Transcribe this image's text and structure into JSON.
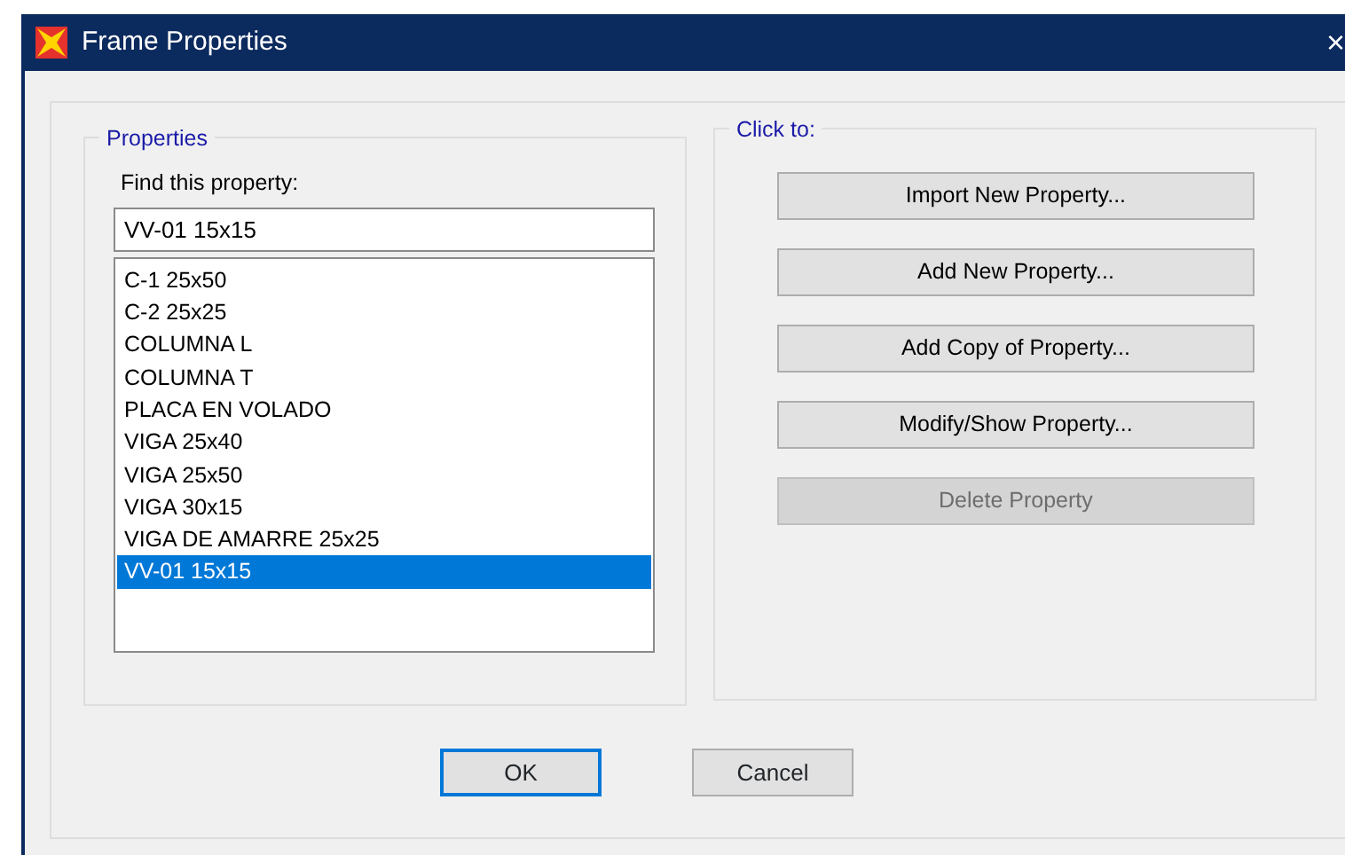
{
  "window": {
    "title": "Frame Properties",
    "close": "×"
  },
  "properties": {
    "legend": "Properties",
    "find_label": "Find this property:",
    "find_value": "VV-01 15x15",
    "items": [
      {
        "label": "C-1 25x50",
        "selected": false
      },
      {
        "label": "C-2 25x25",
        "selected": false
      },
      {
        "label": "COLUMNA L",
        "selected": false
      },
      {
        "label": "COLUMNA T",
        "selected": false
      },
      {
        "label": "PLACA EN VOLADO",
        "selected": false
      },
      {
        "label": "VIGA 25x40",
        "selected": false
      },
      {
        "label": "VIGA 25x50",
        "selected": false
      },
      {
        "label": "VIGA 30x15",
        "selected": false
      },
      {
        "label": "VIGA DE AMARRE 25x25",
        "selected": false
      },
      {
        "label": "VV-01 15x15",
        "selected": true
      }
    ]
  },
  "actions": {
    "legend": "Click to:",
    "buttons": [
      {
        "label": "Import New Property...",
        "disabled": false
      },
      {
        "label": "Add New Property...",
        "disabled": false
      },
      {
        "label": "Add Copy of Property...",
        "disabled": false
      },
      {
        "label": "Modify/Show Property...",
        "disabled": false
      },
      {
        "label": "Delete Property",
        "disabled": true
      }
    ]
  },
  "footer": [
    {
      "label": "OK",
      "default": true
    },
    {
      "label": "Cancel",
      "default": false
    }
  ]
}
